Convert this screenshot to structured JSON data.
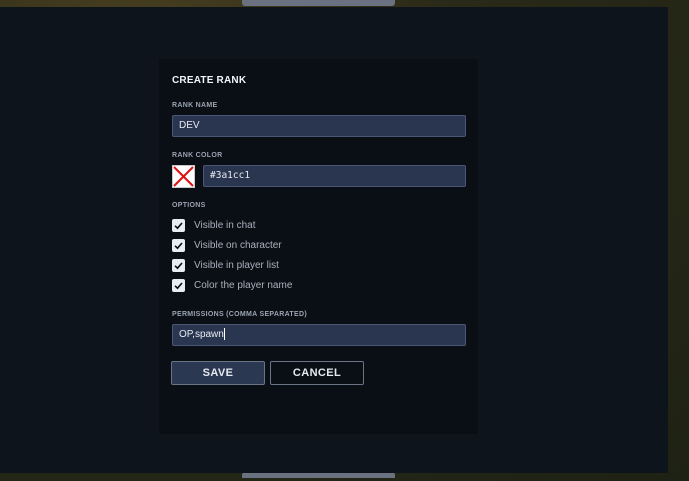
{
  "dialog": {
    "title": "CREATE RANK",
    "rank_name": {
      "label": "RANK NAME",
      "value": "DEV"
    },
    "rank_color": {
      "label": "RANK COLOR",
      "value": "#3a1cc1",
      "swatch_icon": "broken-color-preview"
    },
    "options": {
      "label": "OPTIONS",
      "items": [
        {
          "label": "Visible in chat",
          "checked": true
        },
        {
          "label": "Visible on character",
          "checked": true
        },
        {
          "label": "Visible in player list",
          "checked": true
        },
        {
          "label": "Color the player name",
          "checked": true
        }
      ]
    },
    "permissions": {
      "label": "PERMISSIONS (COMMA SEPARATED)",
      "value": "OP,spawn"
    },
    "save_label": "SAVE",
    "cancel_label": "CANCEL"
  }
}
